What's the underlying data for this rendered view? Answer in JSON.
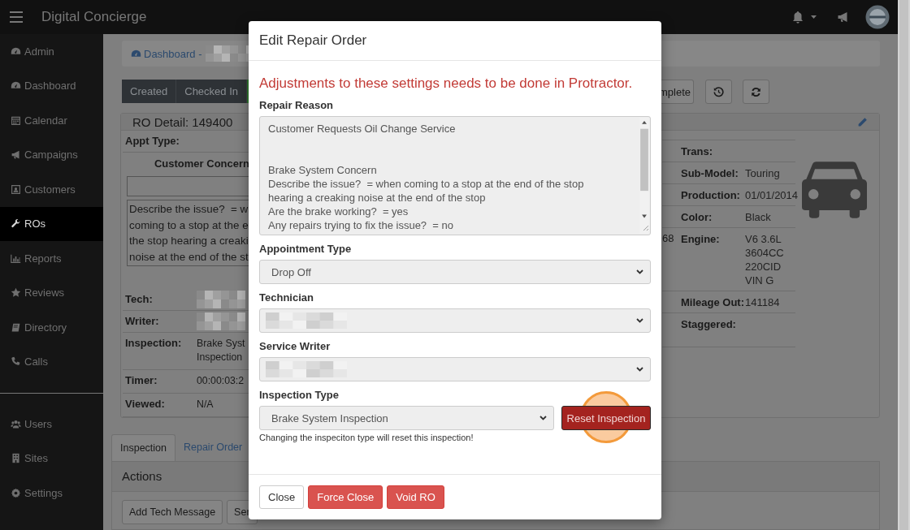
{
  "topbar": {
    "title": "Digital Concierge"
  },
  "sidebar": {
    "sections": [
      [
        {
          "label": "Admin",
          "selected": false
        },
        {
          "label": "Dashboard",
          "selected": false
        },
        {
          "label": "Calendar",
          "selected": false
        },
        {
          "label": "Campaigns",
          "selected": false
        },
        {
          "label": "Customers",
          "selected": false
        },
        {
          "label": "ROs",
          "selected": true
        },
        {
          "label": "Reports",
          "selected": false
        },
        {
          "label": "Reviews",
          "selected": false
        },
        {
          "label": "Directory",
          "selected": false
        },
        {
          "label": "Calls",
          "selected": false
        }
      ],
      [
        {
          "label": "Users",
          "selected": false
        },
        {
          "label": "Sites",
          "selected": false
        },
        {
          "label": "Settings",
          "selected": false
        }
      ]
    ]
  },
  "breadcrumb": {
    "link": "Dashboard -",
    "redacted": true
  },
  "status_steps": [
    {
      "kind": "past",
      "label": "Created"
    },
    {
      "kind": "past",
      "label": "Checked In"
    },
    {
      "kind": "current"
    }
  ],
  "status_buttons": [
    {
      "label": "mplete"
    }
  ],
  "ro_detail": {
    "title": "RO Detail: 149400",
    "left_rows": [
      {
        "kind": "field",
        "label": "Appt Type:"
      },
      {
        "kind": "heading",
        "label": "Customer Concern"
      },
      {
        "kind": "input"
      },
      {
        "kind": "text_box",
        "lines": [
          "Describe the issue?  = w",
          "coming to a stop at the e",
          "the stop hearing a creaki",
          "noise at the end of the st"
        ]
      },
      {
        "kind": "field",
        "label": "Tech:",
        "redacted": true
      },
      {
        "kind": "field",
        "label": "Writer:",
        "redacted": true
      },
      {
        "kind": "field",
        "label": "Inspection:",
        "value": "Brake Syst\nInspection"
      },
      {
        "kind": "field",
        "label": "Timer:",
        "value": "00:00:03:2"
      },
      {
        "kind": "field",
        "label": "Viewed:",
        "value": "N/A"
      }
    ],
    "right_rows": [
      {
        "label": "Trans:"
      },
      {
        "label": "Sub-Model:",
        "value": "Touring"
      },
      {
        "label": "Production:",
        "value": "01/01/2014"
      },
      {
        "label": "Color:",
        "value": "Black"
      },
      {
        "label": "Engine:",
        "value": "V6 3.6L\n3604CC\n220CID\nVIN G",
        "column_1": "68"
      },
      {
        "label": "Mileage Out:",
        "value": "141184"
      },
      {
        "label": "Staggered:"
      }
    ]
  },
  "tabs": [
    {
      "label": "Inspection",
      "selected": true
    },
    {
      "label": "Repair Order",
      "selected": false
    }
  ],
  "actions": {
    "title": "Actions",
    "buttons": [
      "Add Tech Message",
      "Ser"
    ]
  },
  "modal": {
    "title": "Edit Repair Order",
    "warning": "Adjustments to these settings needs to be done in Protractor.",
    "fields": [
      {
        "kind": "textarea",
        "label": "Repair Reason",
        "value": "Customer Requests Oil Change Service\n\n\nBrake System Concern\nDescribe the issue?  = when coming to a stop at the end of the stop hearing a creaking noise at the end of the stop\nAre the brake working?  = yes\nAny repairs trying to fix the issue?  = no"
      },
      {
        "kind": "select",
        "label": "Appointment Type",
        "value": "Drop Off"
      },
      {
        "kind": "select",
        "label": "Technician",
        "redacted": true
      },
      {
        "kind": "select",
        "label": "Service Writer",
        "redacted": true
      },
      {
        "kind": "select_with_button",
        "label": "Inspection Type",
        "value": "Brake System Inspection",
        "button": "Reset Inspection",
        "help": "Changing the inspeciton type will reset this inspection!"
      }
    ],
    "footer_buttons": [
      {
        "label": "Close",
        "kind": "default"
      },
      {
        "label": "Force Close",
        "kind": "danger"
      },
      {
        "label": "Void RO",
        "kind": "danger"
      }
    ]
  }
}
